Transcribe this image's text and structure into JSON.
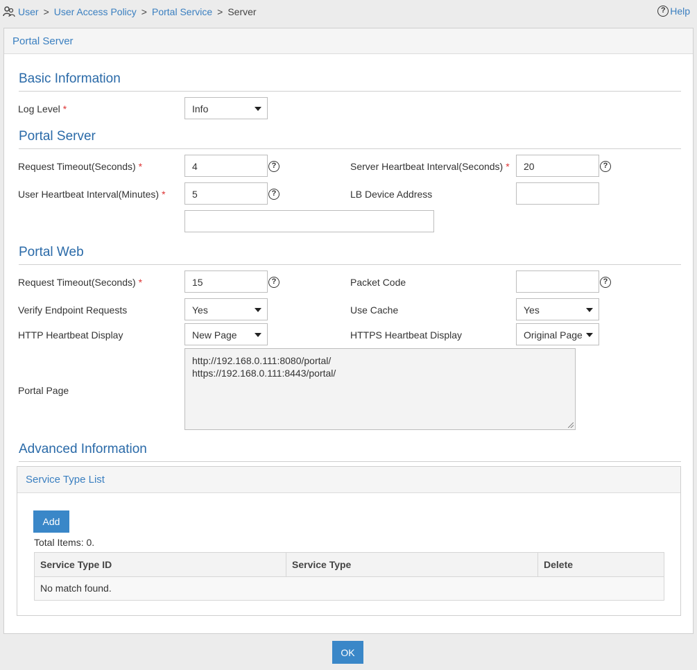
{
  "breadcrumb": {
    "items": [
      "User",
      "User Access Policy",
      "Portal Service"
    ],
    "separator": ">",
    "current": "Server"
  },
  "help_label": "Help",
  "panel_title": "Portal Server",
  "sections": {
    "basic": "Basic Information",
    "portal_server": "Portal Server",
    "portal_web": "Portal Web",
    "advanced": "Advanced Information"
  },
  "basic": {
    "log_level_label": "Log Level",
    "log_level_value": "Info"
  },
  "portal_server": {
    "request_timeout_label": "Request Timeout(Seconds)",
    "request_timeout_value": "4",
    "server_heartbeat_label": "Server Heartbeat Interval(Seconds)",
    "server_heartbeat_value": "20",
    "user_heartbeat_label": "User Heartbeat Interval(Minutes)",
    "user_heartbeat_value": "5",
    "lb_device_label": "LB Device Address",
    "lb_device_value": "",
    "extra_value": ""
  },
  "portal_web": {
    "request_timeout_label": "Request Timeout(Seconds)",
    "request_timeout_value": "15",
    "packet_code_label": "Packet Code",
    "packet_code_value": "",
    "verify_label": "Verify Endpoint Requests",
    "verify_value": "Yes",
    "use_cache_label": "Use Cache",
    "use_cache_value": "Yes",
    "http_hb_label": "HTTP Heartbeat Display",
    "http_hb_value": "New Page",
    "https_hb_label": "HTTPS Heartbeat Display",
    "https_hb_value": "Original Page",
    "portal_page_label": "Portal Page",
    "portal_page_lines": [
      "http://192.168.0.111:8080/portal/",
      "https://192.168.0.111:8443/portal/"
    ]
  },
  "service_list": {
    "title": "Service Type List",
    "add_label": "Add",
    "total": "Total Items: 0.",
    "columns": [
      "Service Type ID",
      "Service Type",
      "Delete"
    ],
    "empty": "No match found."
  },
  "ok_label": "OK",
  "required_mark": "*",
  "help_icon_glyph": "?",
  "colors": {
    "accent": "#3a87c8",
    "link": "#3a7fc0",
    "required": "#d33"
  }
}
